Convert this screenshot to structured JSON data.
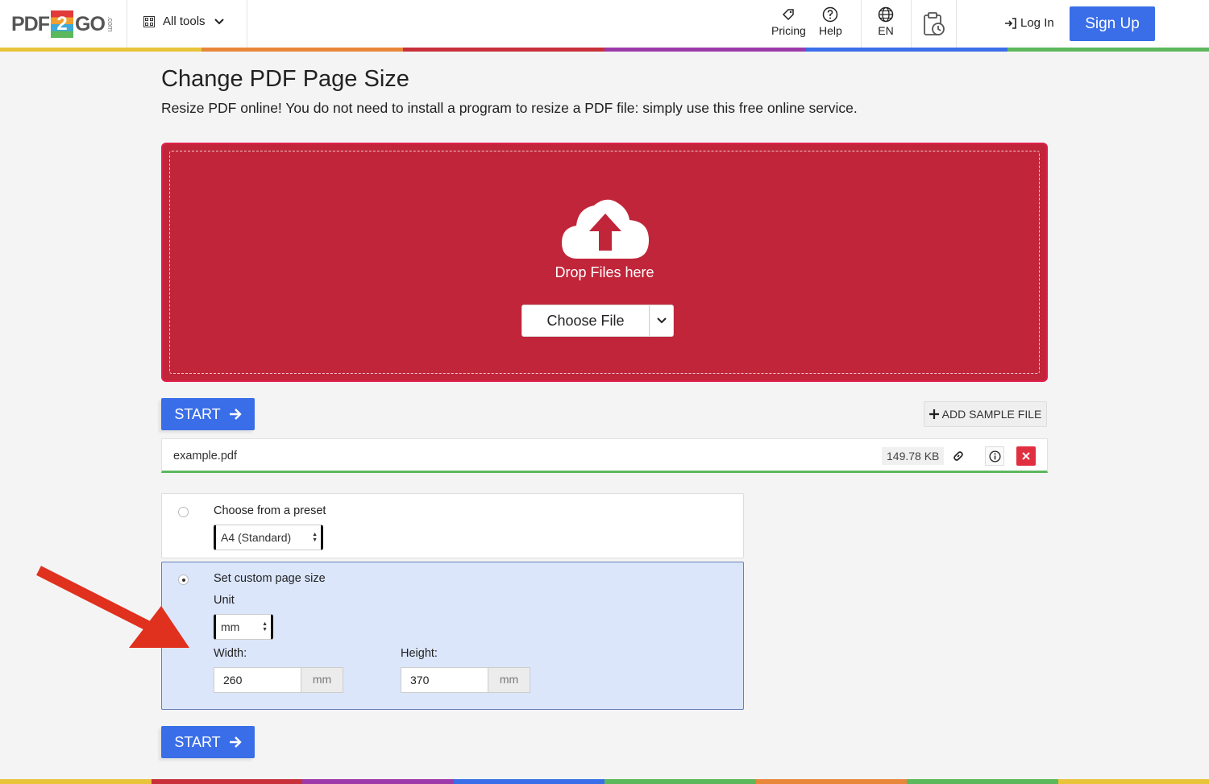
{
  "header": {
    "logo_left": "PDF",
    "logo_num": "2",
    "logo_right": "GO",
    "logo_com": ".com",
    "all_tools": "All tools",
    "pricing": "Pricing",
    "help": "Help",
    "language": "EN",
    "log_in": "Log In",
    "sign_up": "Sign Up"
  },
  "page": {
    "title": "Change PDF Page Size",
    "subtitle": "Resize PDF online! You do not need to install a program to resize a PDF file: simply use this free online service."
  },
  "dropzone": {
    "drop_text": "Drop Files here",
    "choose_file": "Choose File"
  },
  "actions": {
    "start": "START",
    "add_sample": "ADD SAMPLE FILE"
  },
  "file": {
    "name": "example.pdf",
    "size": "149.78 KB"
  },
  "options": {
    "preset_label": "Choose from a preset",
    "preset_value": "A4 (Standard)",
    "custom_label": "Set custom page size",
    "unit_label": "Unit",
    "unit_value": "mm",
    "width_label": "Width:",
    "width_value": "260",
    "width_unit": "mm",
    "height_label": "Height:",
    "height_value": "370",
    "height_unit": "mm",
    "selected": "custom"
  },
  "colors": {
    "accent": "#3a6ee8",
    "dropzone": "#c1253a",
    "rainbow": [
      "#e8c43a",
      "#e8873a",
      "#c8303a",
      "#9b3aa8",
      "#3a6ee8",
      "#5cb85c"
    ]
  },
  "icons": {
    "tools": "grid-icon",
    "pricing": "tag-icon",
    "help": "question-circle-icon",
    "language": "globe-icon",
    "history": "clipboard-clock-icon",
    "login": "sign-in-icon",
    "upload": "cloud-upload-icon",
    "start": "arrow-right-icon",
    "link": "link-icon",
    "info": "info-circle-icon",
    "remove": "close-icon"
  }
}
